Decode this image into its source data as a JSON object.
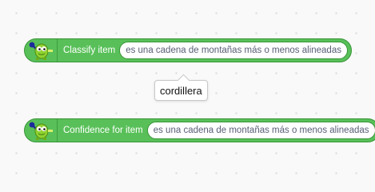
{
  "blocks": [
    {
      "label": "Classify item",
      "input_value": "es una cadena de montañas más o menos alineadas",
      "icon": "robot-mascot-icon"
    },
    {
      "label": "Confidence for item",
      "input_value": "es una cadena de montañas más o menos alineadas",
      "icon": "robot-mascot-icon"
    }
  ],
  "tooltip": {
    "text": "cordillera"
  },
  "colors": {
    "block_fill": "#59c059",
    "block_border": "#389438",
    "canvas_background": "#f9f9f9",
    "grid_dot": "#d6d9de"
  }
}
